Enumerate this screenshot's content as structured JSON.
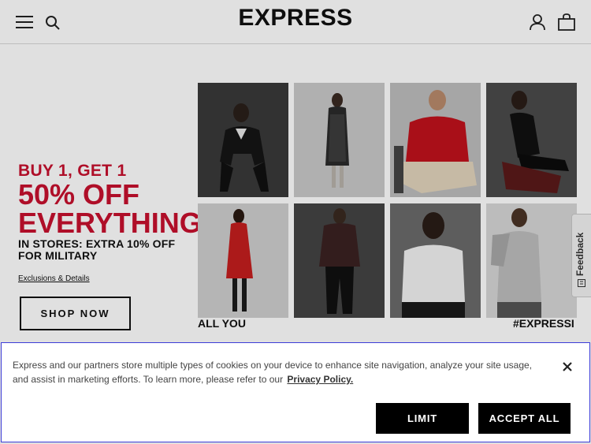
{
  "header": {
    "brand": "EXPRESS",
    "menu_icon": "hamburger-menu-icon",
    "search_icon": "search-icon",
    "account_icon": "user-account-icon",
    "bag_icon": "shopping-bag-icon"
  },
  "hero": {
    "promo_line1": "BUY 1, GET 1",
    "promo_line2": "50% OFF",
    "promo_line3": "EVERYTHING",
    "promo_stores": "IN STORES: EXTRA 10% OFF FOR MILITARY",
    "exclusions_link": "Exclusions & Details",
    "shop_now": "SHOP NOW",
    "caption_left": "ALL YOU",
    "caption_right": "#EXPRESSI",
    "accent_color": "#c8102e",
    "tiles": [
      "man-in-dark-sweater-crouching",
      "woman-in-patterned-coat",
      "man-in-red-sweater-seated",
      "woman-in-black-dress-on-chair",
      "woman-in-red-knit-dress",
      "man-in-plaid-shirt-jacket",
      "woman-in-white-tee",
      "man-in-grey-cable-sweater"
    ]
  },
  "feedback": {
    "label": "Feedback"
  },
  "cookie": {
    "text": "Express and our partners store multiple types of cookies on your device to enhance site navigation, analyze your site usage, and assist in marketing efforts. To learn more, please refer to our",
    "privacy_link": "Privacy Policy.",
    "limit_label": "LIMIT",
    "accept_label": "ACCEPT ALL",
    "close_icon": "close-icon"
  }
}
